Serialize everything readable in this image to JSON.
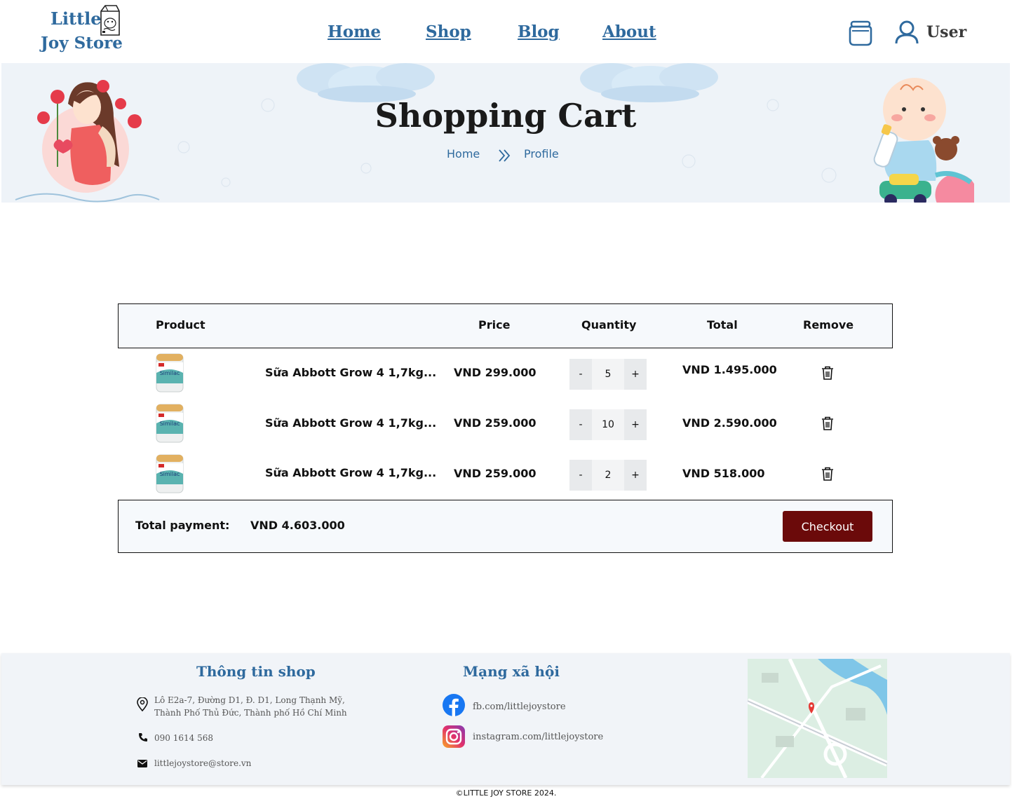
{
  "header": {
    "logo_line1": "Little",
    "logo_line2": "Joy Store",
    "nav": [
      "Home",
      "Shop",
      "Blog",
      "About"
    ],
    "user_label": "User"
  },
  "banner": {
    "title": "Shopping Cart",
    "breadcrumb": [
      "Home",
      "Profile"
    ]
  },
  "cart": {
    "columns": [
      "Product",
      "Price",
      "Quantity",
      "Total",
      "Remove"
    ],
    "items": [
      {
        "name": "Sữa Abbott Grow 4 1,7kg...",
        "price": "VND 299.000",
        "qty": "5",
        "total": "VND 1.495.000"
      },
      {
        "name": "Sữa Abbott Grow 4 1,7kg...",
        "price": "VND 259.000",
        "qty": "10",
        "total": "VND 2.590.000"
      },
      {
        "name": "Sữa Abbott Grow 4 1,7kg...",
        "price": "VND 259.000",
        "qty": "2",
        "total": "VND 518.000"
      }
    ],
    "minus_label": "-",
    "plus_label": "+",
    "total_label": "Total payment:",
    "total_value": "VND 4.603.000",
    "checkout_label": "Checkout"
  },
  "footer": {
    "shop_title": "Thông tin shop",
    "address_line1": "Lô E2a-7, Đường D1, Đ. D1, Long Thạnh Mỹ,",
    "address_line2": "Thành Phố Thủ Đức, Thành phố Hồ Chí Minh",
    "phone": "090 1614 568",
    "email": "littlejoystore@store.vn",
    "social_title": "Mạng xã hội",
    "facebook": "fb.com/littlejoystore",
    "instagram": "instagram.com/littlejoystore",
    "copyright": "©LITTLE JOY STORE 2024."
  },
  "colors": {
    "brand_blue": "#2f6a9e",
    "checkout_red": "#6b0a0a",
    "banner_bg": "#eef3f8"
  }
}
